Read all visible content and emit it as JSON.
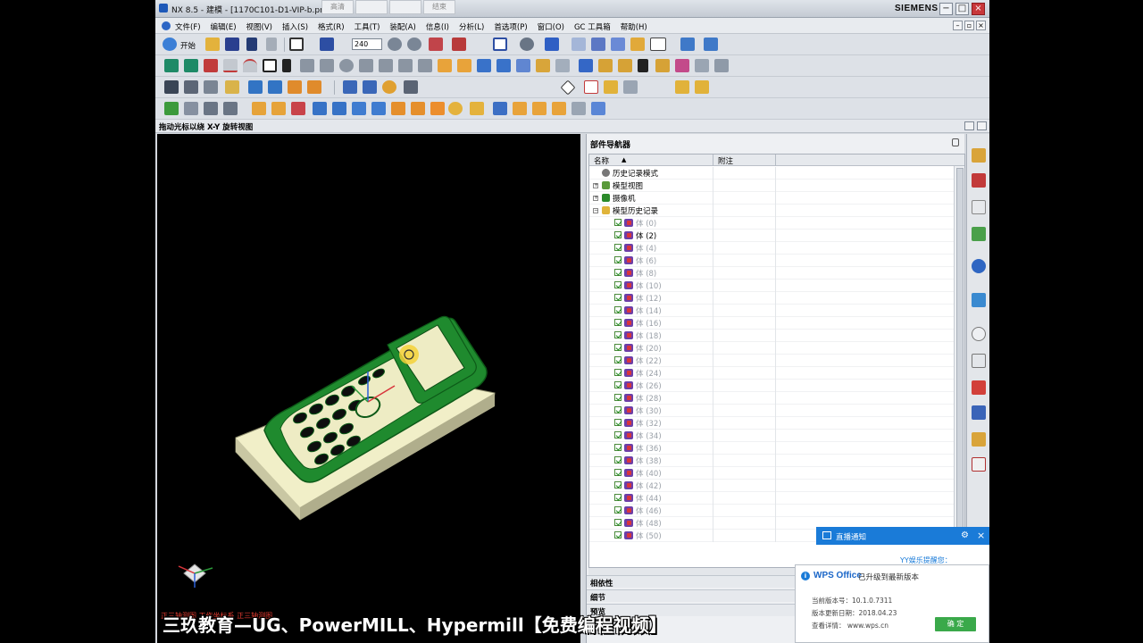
{
  "window": {
    "title": "NX 8.5 - 建模 - [1170C101-D1-VIP-b.prt  (",
    "brand": "SIEMENS",
    "overlay_tabs": [
      "高清",
      "",
      "",
      "结束"
    ],
    "controls": {
      "minimize": "−",
      "maximize": "□",
      "close": "×"
    }
  },
  "menubar": {
    "items": [
      "文件(F)",
      "编辑(E)",
      "视图(V)",
      "插入(S)",
      "格式(R)",
      "工具(T)",
      "装配(A)",
      "信息(I)",
      "分析(L)",
      "首选项(P)",
      "窗口(O)",
      "GC 工具箱",
      "帮助(H)"
    ],
    "doc_controls": {
      "minimize": "–",
      "restore": "▫",
      "close": "×"
    }
  },
  "toolbar": {
    "start_label": "开始",
    "zoom_value": "240"
  },
  "statusline": {
    "prompt": "拖动光标以绕 X-Y 旋转视图"
  },
  "viewport": {
    "status_text": "正三轴测图 工作坐标系 正三轴测图"
  },
  "navigator": {
    "title": "部件导航器",
    "columns": {
      "name": "名称",
      "note": "附注"
    },
    "top_items": [
      {
        "label": "历史记录模式",
        "icon": "history-icon"
      },
      {
        "label": "模型视图",
        "icon": "model-views-icon"
      },
      {
        "label": "摄像机",
        "icon": "camera-icon"
      },
      {
        "label": "模型历史记录",
        "icon": "folder-icon"
      }
    ],
    "features": [
      {
        "label": "体 (0)",
        "active": false
      },
      {
        "label": "体 (2)",
        "active": true
      },
      {
        "label": "体 (4)",
        "active": false
      },
      {
        "label": "体 (6)",
        "active": false
      },
      {
        "label": "体 (8)",
        "active": false
      },
      {
        "label": "体 (10)",
        "active": false
      },
      {
        "label": "体 (12)",
        "active": false
      },
      {
        "label": "体 (14)",
        "active": false
      },
      {
        "label": "体 (16)",
        "active": false
      },
      {
        "label": "体 (18)",
        "active": false
      },
      {
        "label": "体 (20)",
        "active": false
      },
      {
        "label": "体 (22)",
        "active": false
      },
      {
        "label": "体 (24)",
        "active": false
      },
      {
        "label": "体 (26)",
        "active": false
      },
      {
        "label": "体 (28)",
        "active": false
      },
      {
        "label": "体 (30)",
        "active": false
      },
      {
        "label": "体 (32)",
        "active": false
      },
      {
        "label": "体 (34)",
        "active": false
      },
      {
        "label": "体 (36)",
        "active": false
      },
      {
        "label": "体 (38)",
        "active": false
      },
      {
        "label": "体 (40)",
        "active": false
      },
      {
        "label": "体 (42)",
        "active": false
      },
      {
        "label": "体 (44)",
        "active": false
      },
      {
        "label": "体 (46)",
        "active": false
      },
      {
        "label": "体 (48)",
        "active": false
      },
      {
        "label": "体 (50)",
        "active": false
      }
    ],
    "panels": {
      "dependencies": "相依性",
      "details": "细节",
      "preview": "预览"
    }
  },
  "notification": {
    "header": "直播通知",
    "strip_text": "YY娱乐提醒您：",
    "brand": "WPS Office",
    "headline": "已升级到最新版本",
    "version_line": "当前版本号：10.1.0.7311",
    "date_line": "版本更新日期：2018.04.23",
    "details_line": "查看详情： www.wps.cn",
    "ok_label": "确 定"
  },
  "watermark": "三玖教育—UG、PowerMILL、Hypermill【免费编程视频】",
  "colors": {
    "accent_blue": "#1a7bd8",
    "model_green": "#1f8a2e",
    "model_cream": "#f1efc8",
    "ok_green": "#3aa94a"
  }
}
